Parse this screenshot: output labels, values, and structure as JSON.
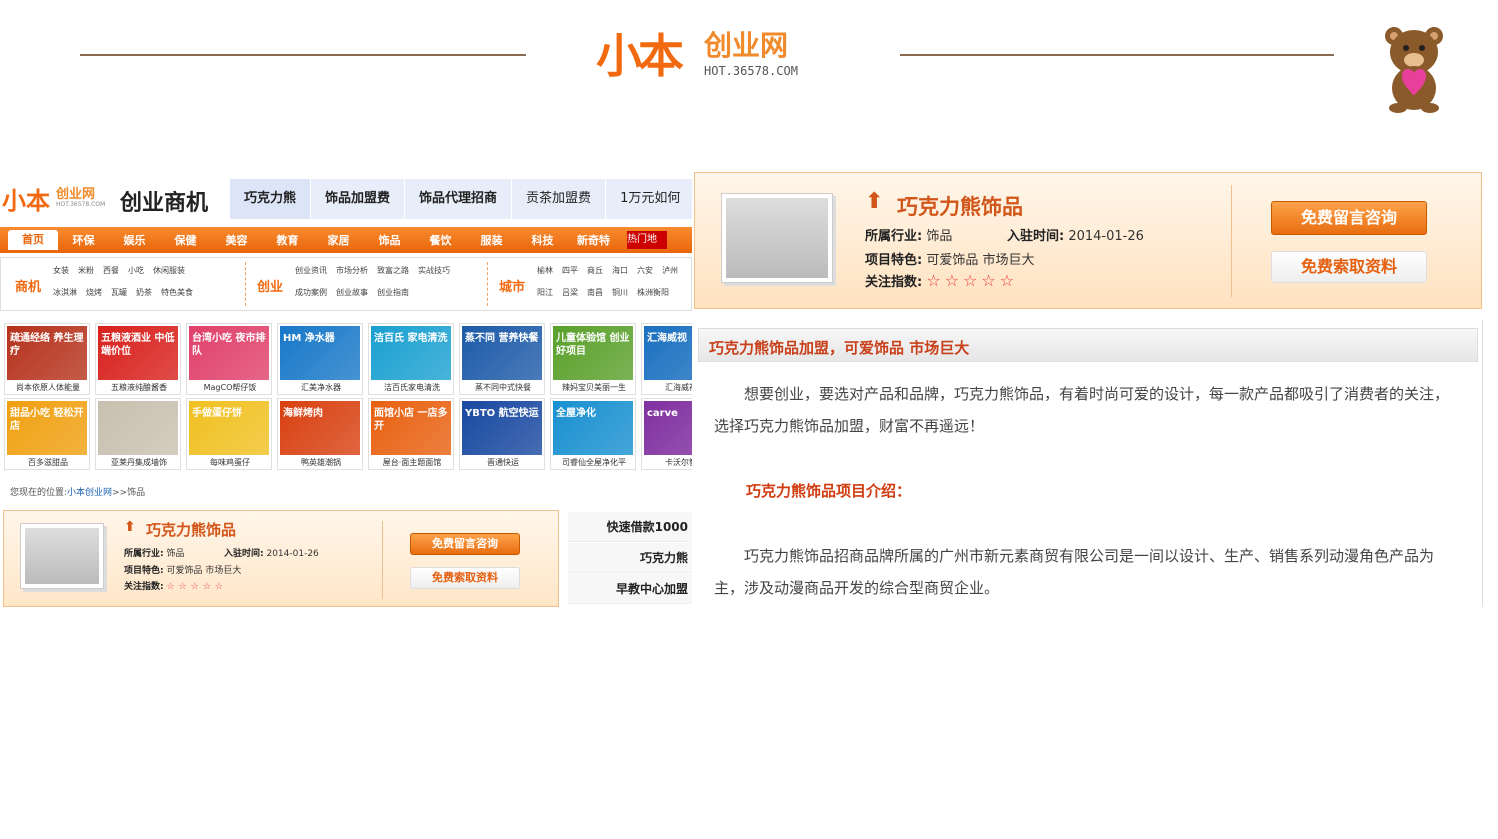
{
  "header": {
    "logo_mark": "小本",
    "logo_name": "创业网",
    "logo_url": "HOT.36578.COM"
  },
  "left": {
    "logo_mark": "小本",
    "logo_name": "创业网",
    "logo_url": "HOT.36578.COM",
    "site_title": "创业商机",
    "tabs": [
      "巧克力熊",
      "饰品加盟费",
      "饰品代理招商",
      "贡茶加盟费",
      "1万元如何"
    ],
    "nav": {
      "home": "首页",
      "items": [
        "环保",
        "娱乐",
        "保健",
        "美容",
        "教育",
        "家居",
        "饰品",
        "餐饮",
        "服装",
        "科技",
        "新奇特"
      ],
      "hot": "热门地"
    },
    "categories": {
      "biz_label": "商机",
      "biz_row1": [
        "女装",
        "米粉",
        "西餐",
        "小吃",
        "休闲服装"
      ],
      "biz_row2": [
        "冰淇淋",
        "烧烤",
        "瓦罐",
        "奶茶",
        "特色美食"
      ],
      "start_label": "创业",
      "start_row1": [
        "创业资讯",
        "市场分析",
        "致富之路",
        "实战技巧"
      ],
      "start_row2": [
        "成功案例",
        "创业故事",
        "创业指南"
      ],
      "city_label": "城市",
      "city_row1": [
        "榆林",
        "四平",
        "商丘",
        "海口",
        "六安",
        "泸州"
      ],
      "city_row2": [
        "阳江",
        "吕梁",
        "南昌",
        "铜川",
        "株洲衡阳"
      ]
    },
    "grid": [
      {
        "caption": "尚本依原人体能量",
        "img_text": "疏通经络 养生理疗",
        "color": "#b5321c"
      },
      {
        "caption": "五粮液纯酿酱香",
        "img_text": "五粮液酒业 中低端价位",
        "color": "#d8201c"
      },
      {
        "caption": "MagCO帮仔饭",
        "img_text": "台湾小吃 夜市排队",
        "color": "#e0406a"
      },
      {
        "caption": "汇美净水器",
        "img_text": "HM 净水器",
        "color": "#1878c8"
      },
      {
        "caption": "洁百氏家电清洗",
        "img_text": "洁百氏 家电清洗",
        "color": "#1aa0d0"
      },
      {
        "caption": "蒸不同中式快餐",
        "img_text": "蒸不同 营养快餐",
        "color": "#1c5aa8"
      },
      {
        "caption": "辣妈宝贝美丽一生",
        "img_text": "儿童体验馆 创业好项目",
        "color": "#5aa02a"
      },
      {
        "caption": "汇海威视视",
        "img_text": "汇海威视",
        "color": "#1a70c0"
      },
      {
        "caption": "百多滋甜品",
        "img_text": "甜品小吃 轻松开店",
        "color": "#f0a010"
      },
      {
        "caption": "亚莱丹集成墙饰",
        "img_text": "",
        "color": "#c8c0b0"
      },
      {
        "caption": "每味鸡蛋仔",
        "img_text": "手做蛋仔饼",
        "color": "#f0c020"
      },
      {
        "caption": "鸭英雄潮锅",
        "img_text": "海鲜烤肉",
        "color": "#d84010"
      },
      {
        "caption": "屋台·面主题面馆",
        "img_text": "面馆小店 一店多开",
        "color": "#e86010"
      },
      {
        "caption": "晋通快运",
        "img_text": "YBTO 航空快运",
        "color": "#1848a0"
      },
      {
        "caption": "司睿仙全屋净化平",
        "img_text": "全屋净化",
        "color": "#1890d0"
      },
      {
        "caption": "卡沃尔智能",
        "img_text": "carve",
        "color": "#8030a0"
      }
    ],
    "breadcrumb_prefix": "您现在的位置:",
    "breadcrumb_link": "小本创业网",
    "breadcrumb_current": ">>饰品",
    "side_list": [
      "快速借款1000",
      "巧克力熊",
      "早教中心加盟"
    ]
  },
  "brand": {
    "name": "巧克力熊饰品",
    "industry_label": "所属行业:",
    "industry": "饰品",
    "joined_label": "入驻时间:",
    "joined": "2014-01-26",
    "feature_label": "项目特色:",
    "feature": "可爱饰品 市场巨大",
    "attention_label": "关注指数:",
    "stars": "☆☆☆☆☆",
    "btn_consult": "免费留言咨询",
    "btn_request": "免费索取资料"
  },
  "article": {
    "heading": "巧克力熊饰品加盟，可爱饰品 市场巨大",
    "para1_line1": "想要创业，要选对产品和品牌，巧克力熊饰品，有着时尚可爱的设计，每一款产品都吸引了消费者的关注，",
    "para1_line2": "选择巧克力熊饰品加盟，财富不再遥远！",
    "section_title": "巧克力熊饰品项目介绍：",
    "para2_line1": "巧克力熊饰品招商品牌所属的广州市新元素商贸有限公司是一间以设计、生产、销售系列动漫角色产品为",
    "para2_line2": "主，涉及动漫商品开发的综合型商贸企业。"
  }
}
